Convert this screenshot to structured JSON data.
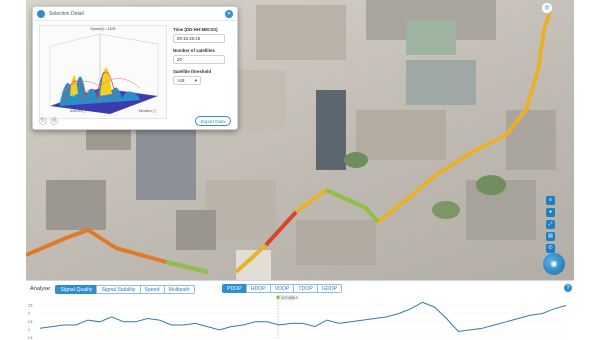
{
  "dialog": {
    "title": "Selection Detail",
    "plot_title": "Epoch(t) = 1878",
    "plot_xlabel": "Azimuth (°)",
    "plot_ylabel": "Elevation (°)",
    "time_label": "Time (DD:HH:MM:SS)",
    "time_value": "00:15:26:15",
    "satellites_label": "Number of satellites",
    "satellites_value": "20",
    "threshold_label": "Satellite threshold",
    "threshold_value": ">15",
    "export_label": "Export Data"
  },
  "icons": {
    "title": "circle-icon",
    "close": "close-icon",
    "dialog_tools": [
      "rotate-icon",
      "reset-icon"
    ],
    "right_toolbar": [
      "layers-icon",
      "pin-icon",
      "distance-icon",
      "ruler-icon",
      "phone-icon"
    ],
    "globe": "globe-icon",
    "compass": "compass-icon",
    "help": "help-icon"
  },
  "panel": {
    "analyse_label": "Analyse:",
    "tabs": [
      "Signal Quality",
      "Signal Stability",
      "Speed",
      "Multipath"
    ],
    "active_tab": "Signal Quality",
    "dop_tabs": [
      "PDOP",
      "HDOP",
      "VDOP",
      "TDOP",
      "GDOP"
    ],
    "active_dop": "PDOP",
    "marker_label": "SCROBBLE"
  },
  "chart_data": {
    "type": "line",
    "series": [
      {
        "values": [
          2.1,
          2.2,
          2.3,
          2.3,
          2.6,
          2.5,
          2.8,
          2.5,
          2.5,
          2.7,
          2.6,
          2.3,
          2.3,
          2.4,
          2.2,
          2.0,
          2.2,
          2.3,
          2.5,
          2.5,
          2.3,
          2.4,
          2.4,
          2.2,
          2.6,
          2.4,
          2.5,
          2.6,
          2.7,
          2.8,
          3.0,
          3.3,
          3.7,
          3.4,
          2.7,
          1.9,
          2.0,
          2.1,
          2.3,
          2.5,
          2.7,
          2.9,
          3.0,
          3.3,
          3.5
        ]
      }
    ],
    "yticks": [
      "1.5",
      "2",
      "2.5",
      "3",
      "3.5"
    ],
    "ylim": [
      1.5,
      3.9
    ],
    "colors": {
      "line": "#2f7fa5",
      "accent": "#2d8fd0"
    }
  }
}
